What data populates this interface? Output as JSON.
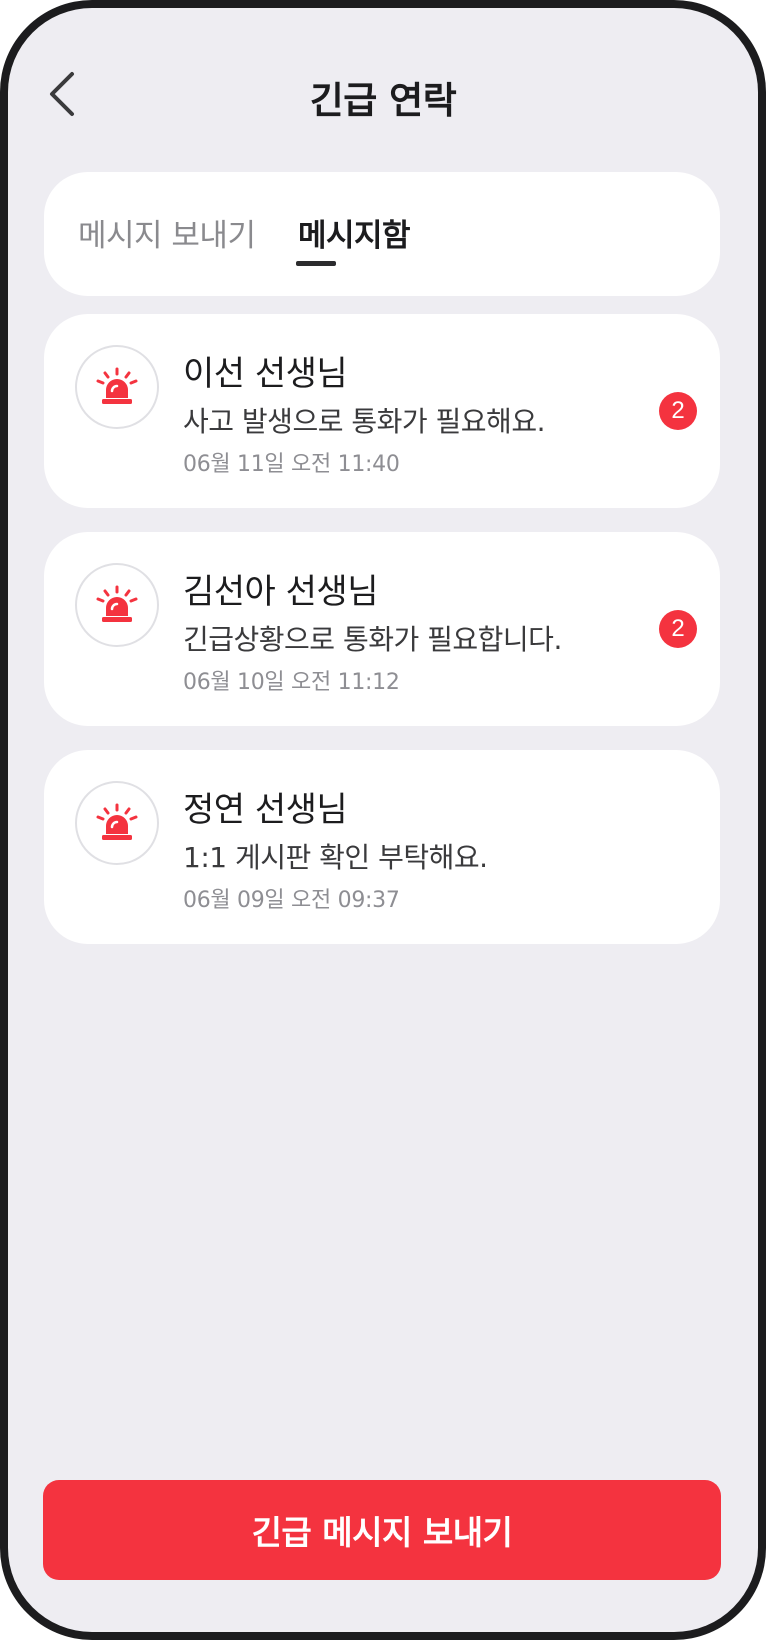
{
  "header": {
    "title": "긴급 연락",
    "back_icon": "chevron-left-icon"
  },
  "tabs": [
    {
      "label": "메시지 보내기",
      "selected": false
    },
    {
      "label": "메시지함",
      "selected": true
    }
  ],
  "messages": [
    {
      "sender": "이선 선생님",
      "preview": "사고 발생으로 통화가 필요해요.",
      "timestamp": "06월 11일 오전 11:40",
      "unread": "2",
      "icon": "siren-icon"
    },
    {
      "sender": "김선아 선생님",
      "preview": "긴급상황으로 통화가 필요합니다.",
      "timestamp": "06월 10일 오전 11:12",
      "unread": "2",
      "icon": "siren-icon"
    },
    {
      "sender": "정연 선생님",
      "preview": "1:1 게시판 확인 부탁해요.",
      "timestamp": "06월 09일 오전 09:37",
      "unread": "",
      "icon": "siren-icon"
    }
  ],
  "cta": {
    "label": "긴급 메시지 보내기"
  },
  "colors": {
    "accent": "#f4333f",
    "background": "#eeedf2",
    "card": "#ffffff",
    "text_primary": "#1c1c1e",
    "text_secondary": "#8e8e93"
  }
}
